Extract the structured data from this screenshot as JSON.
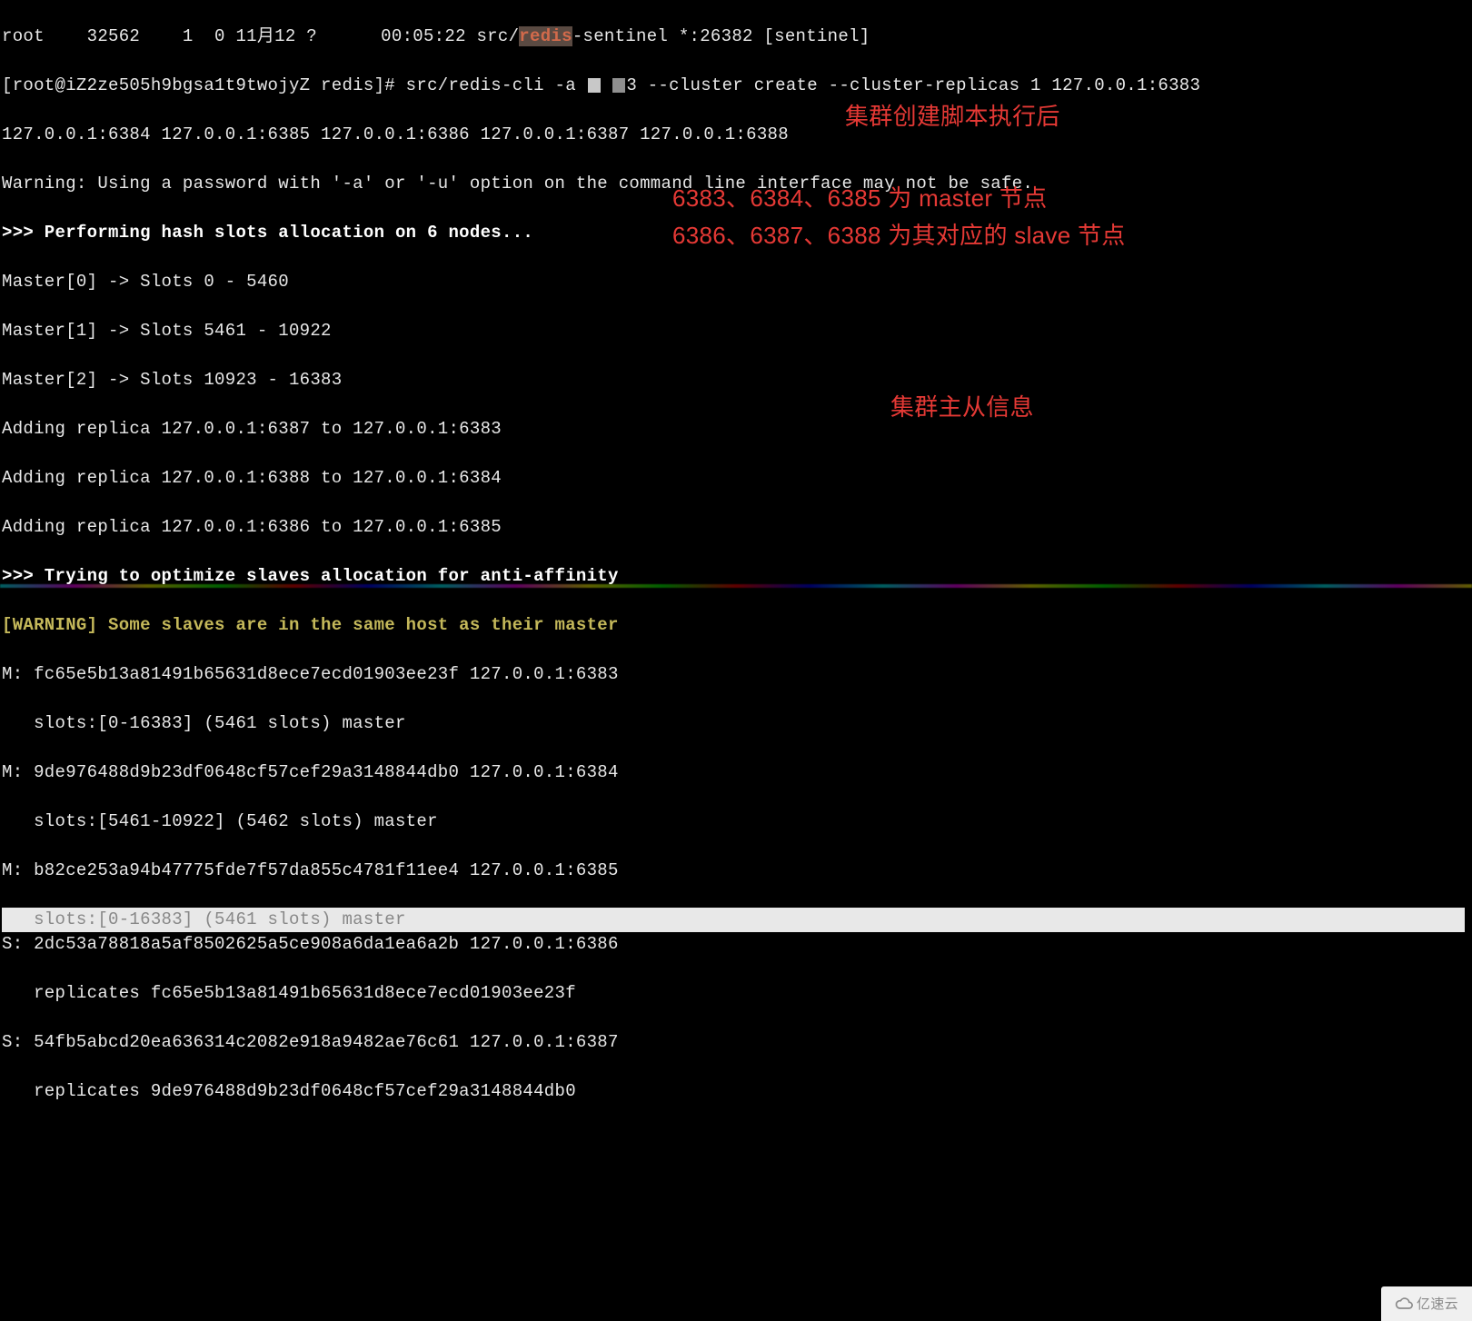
{
  "terminal": {
    "ps_line_pre": "root    32562    1  0 11月12 ?      00:05:22 src/",
    "ps_line_highlight": "redis",
    "ps_line_post": "-sentinel *:26382 [sentinel]",
    "prompt_pre": "[root@iZ2ze505h9bgsa1t9twojyZ redis]# src/redis-cli -a ",
    "prompt_mid": "3 --cluster create --cluster-replicas 1 127.0.0.1:6383 ",
    "addresses_line": "127.0.0.1:6384 127.0.0.1:6385 127.0.0.1:6386 127.0.0.1:6387 127.0.0.1:6388",
    "warning_line": "Warning: Using a password with '-a' or '-u' option on the command line interface may not be safe.",
    "perform_line": ">>> Performing hash slots allocation on 6 nodes...",
    "master0": "Master[0] -> Slots 0 - 5460",
    "master1": "Master[1] -> Slots 5461 - 10922",
    "master2": "Master[2] -> Slots 10923 - 16383",
    "addrep1": "Adding replica 127.0.0.1:6387 to 127.0.0.1:6383",
    "addrep2": "Adding replica 127.0.0.1:6388 to 127.0.0.1:6384",
    "addrep3": "Adding replica 127.0.0.1:6386 to 127.0.0.1:6385",
    "optimize_line": ">>> Trying to optimize slaves allocation for anti-affinity",
    "warn_same_host": "[WARNING] Some slaves are in the same host as their master",
    "m1_a": "M: fc65e5b13a81491b65631d8ece7ecd01903ee23f 127.0.0.1:6383",
    "m1_b": "   slots:[0-16383] (5461 slots) master",
    "m2_a": "M: 9de976488d9b23df0648cf57cef29a3148844db0 127.0.0.1:6384",
    "m2_b": "   slots:[5461-10922] (5462 slots) master",
    "m3_a": "M: b82ce253a94b47775fde7f57da855c4781f11ee4 127.0.0.1:6385",
    "m3_b": "   slots:[0-16383] (5461 slots) master",
    "s1_a": "S: 2dc53a78818a5af8502625a5ce908a6da1ea6a2b 127.0.0.1:6386",
    "s1_b": "   replicates fc65e5b13a81491b65631d8ece7ecd01903ee23f",
    "s2_a": "S: 54fb5abcd20ea636314c2082e918a9482ae76c61 127.0.0.1:6387",
    "s2_b": "   replicates 9de976488d9b23df0648cf57cef29a3148844db0"
  },
  "annotations": {
    "a1": "集群创建脚本执行后",
    "a2": "6383、6384、6385 为 master 节点",
    "a3": "6386、6387、6388 为其对应的 slave 节点",
    "a4": "集群主从信息"
  },
  "watermark": {
    "text": "亿速云"
  }
}
